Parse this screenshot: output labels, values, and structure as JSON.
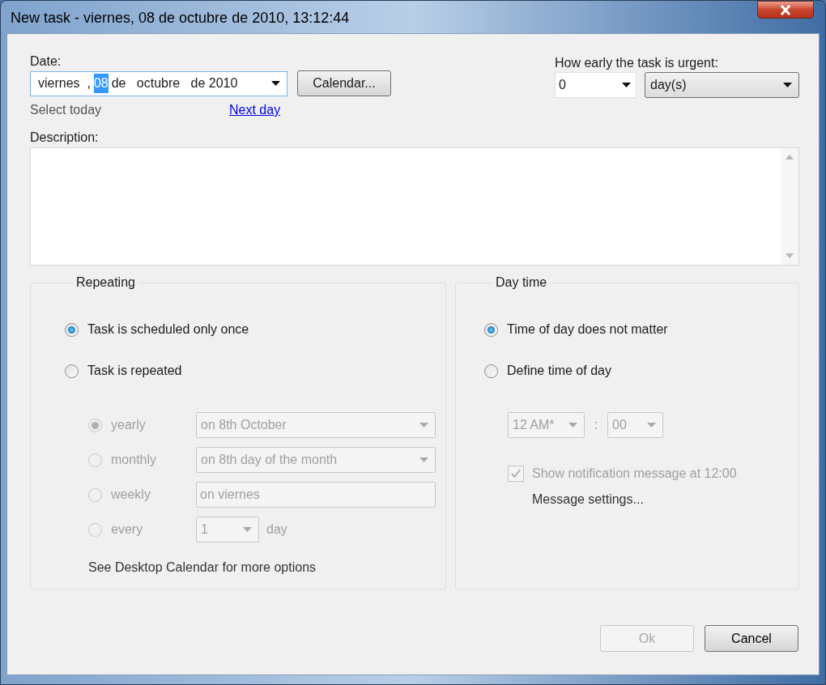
{
  "window": {
    "title": "New task - viernes, 08 de octubre de 2010, 13:12:44"
  },
  "date": {
    "label": "Date:",
    "segments": [
      {
        "text": "viernes  ,",
        "selected": false
      },
      {
        "text": "08",
        "selected": true
      },
      {
        "text": "de   octubre   de 2010",
        "selected": false
      }
    ],
    "calendar_button": "Calendar...",
    "select_today": "Select today",
    "next_day": "Next day"
  },
  "urgency": {
    "label": "How early the task is urgent:",
    "amount": "0",
    "unit": "day(s)"
  },
  "description": {
    "label": "Description:"
  },
  "repeating": {
    "title": "Repeating",
    "options": [
      {
        "label": "Task is scheduled only once",
        "selected": true
      },
      {
        "label": "Task is repeated",
        "selected": false
      }
    ],
    "sub_disabled": true,
    "sub_options": [
      {
        "label": "yearly",
        "selected": true,
        "kind": "dropdown",
        "value": "on 8th October"
      },
      {
        "label": "monthly",
        "selected": false,
        "kind": "dropdown",
        "value": "on 8th day of the month"
      },
      {
        "label": "weekly",
        "selected": false,
        "kind": "text",
        "value": "on viernes"
      },
      {
        "label": "every",
        "selected": false,
        "kind": "spin",
        "value": "1",
        "unit": "day"
      }
    ],
    "note": "See Desktop Calendar for more options"
  },
  "day_time": {
    "title": "Day time",
    "options": [
      {
        "label": "Time of day does not matter",
        "selected": true
      },
      {
        "label": "Define time of day",
        "selected": false
      }
    ],
    "time_disabled": true,
    "hour": "12 AM*",
    "separator": ":",
    "minute": "00",
    "notification": {
      "label": "Show notification message at 12:00",
      "checked": true,
      "disabled": true
    },
    "message_settings": "Message settings..."
  },
  "buttons": [
    {
      "label": "Ok",
      "disabled": true
    },
    {
      "label": "Cancel",
      "disabled": false
    }
  ]
}
